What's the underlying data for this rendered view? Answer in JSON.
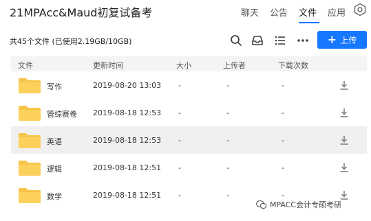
{
  "header": {
    "title": "21MPAcc&Maud初复试备考",
    "nav": [
      {
        "label": "聊天"
      },
      {
        "label": "公告"
      },
      {
        "label": "文件"
      },
      {
        "label": "应用"
      }
    ],
    "active_tab": "文件",
    "accent_color": "#1677ff"
  },
  "toolbar": {
    "file_count": "共45个文件 (已使用2.19GB/10GB)",
    "upload_label": "上传",
    "icons": [
      "search-icon",
      "inbox-icon",
      "list-view-icon",
      "more-icon"
    ]
  },
  "table": {
    "headers": {
      "file": "文件",
      "updated": "更新时间",
      "size": "大小",
      "uploader": "上传者",
      "downloads": "下载次数"
    },
    "rows": [
      {
        "name": "写作",
        "time": "2019-08-20 13:03",
        "size": "-",
        "uploader": "-",
        "downloads": "-"
      },
      {
        "name": "管综赛卷",
        "time": "2019-08-18 12:53",
        "size": "-",
        "uploader": "-",
        "downloads": "-"
      },
      {
        "name": "英语",
        "time": "2019-08-18 12:53",
        "size": "-",
        "uploader": "-",
        "downloads": "-"
      },
      {
        "name": "逻辑",
        "time": "2019-08-18 12:51",
        "size": "-",
        "uploader": "-",
        "downloads": "-"
      },
      {
        "name": "数学",
        "time": "2019-08-18 12:51",
        "size": "-",
        "uploader": "-",
        "downloads": "-"
      }
    ],
    "folder_color": "#f7c54a"
  },
  "watermark": {
    "text": "MPACC会计专硕考研"
  }
}
